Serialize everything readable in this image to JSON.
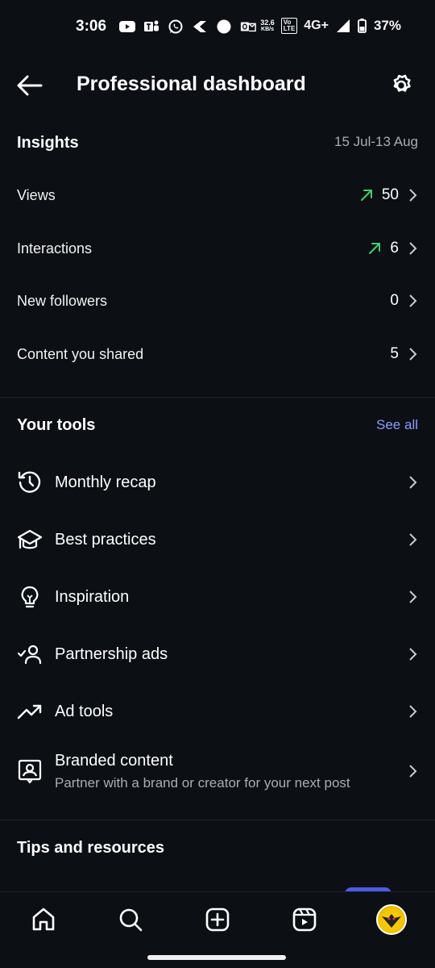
{
  "status_bar": {
    "time": "3:06",
    "net_speed_value": "32.6",
    "net_speed_unit": "KB/s",
    "volte_top": "Vo",
    "volte_bottom": "LTE",
    "network": "4G+",
    "battery": "37%",
    "icons": [
      "youtube-icon",
      "teams-icon",
      "whatsapp-icon",
      "app-icon",
      "circle-icon",
      "outlook-icon",
      "signal-icon",
      "battery-icon"
    ]
  },
  "header": {
    "title": "Professional dashboard"
  },
  "insights": {
    "title": "Insights",
    "date_range": "15 Jul-13 Aug",
    "metrics": [
      {
        "label": "Views",
        "value": "50",
        "trend": "up"
      },
      {
        "label": "Interactions",
        "value": "6",
        "trend": "up"
      },
      {
        "label": "New followers",
        "value": "0",
        "trend": "none"
      },
      {
        "label": "Content you shared",
        "value": "5",
        "trend": "none"
      }
    ]
  },
  "tools": {
    "title": "Your tools",
    "see_all": "See all",
    "items": [
      {
        "label": "Monthly recap",
        "icon": "history-icon"
      },
      {
        "label": "Best practices",
        "icon": "graduation-cap-icon"
      },
      {
        "label": "Inspiration",
        "icon": "lightbulb-icon"
      },
      {
        "label": "Partnership ads",
        "icon": "partnership-icon"
      },
      {
        "label": "Ad tools",
        "icon": "trending-up-icon"
      },
      {
        "label": "Branded content",
        "subtitle": "Partner with a brand or creator for your next post",
        "icon": "branded-content-icon"
      }
    ]
  },
  "tips": {
    "title": "Tips and resources"
  },
  "colors": {
    "background": "#0c0f14",
    "accent": "#8b9cff",
    "trend_up": "#3fd16c",
    "muted_text": "#a8adb5"
  }
}
